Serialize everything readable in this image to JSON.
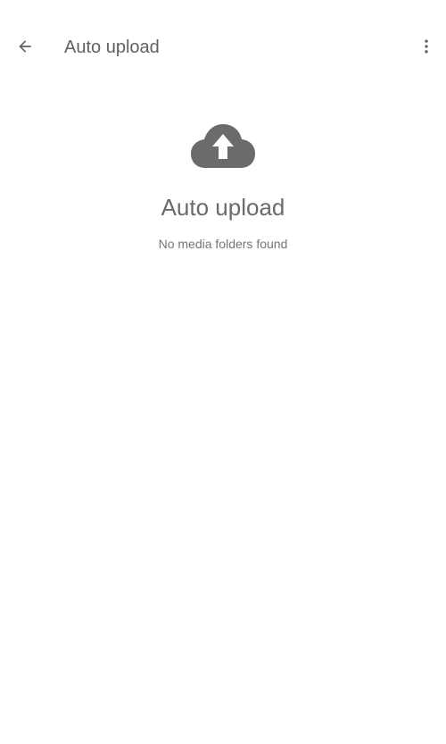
{
  "app_bar": {
    "title": "Auto upload",
    "back_icon": "arrow-back-icon",
    "menu_icon": "more-vert-icon"
  },
  "empty_state": {
    "icon": "cloud-upload-icon",
    "title": "Auto upload",
    "message": "No media folders found"
  },
  "colors": {
    "icon": "#6b6b6b",
    "title_text": "#616161",
    "body_text": "#757575",
    "background": "#ffffff"
  }
}
